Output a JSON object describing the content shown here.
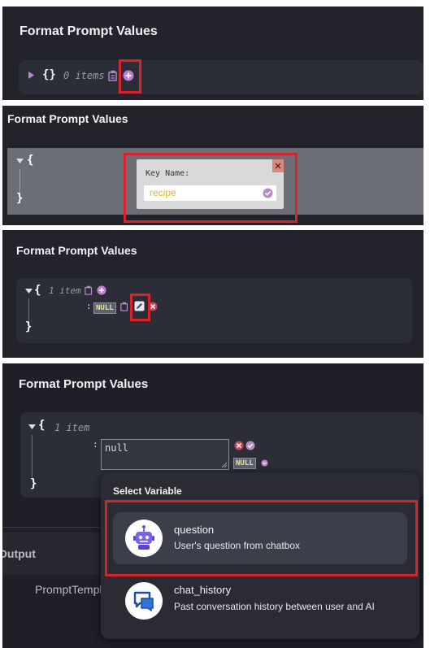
{
  "colors": {
    "panel_bg": "#22232b",
    "json_bg": "#2b2d37",
    "highlight": "#d8232a",
    "accent_purple": "#c27ad9",
    "null_text": "#f0e2a0"
  },
  "panel1": {
    "title": "Format Prompt Values",
    "brace": "{}",
    "items_count": "0 items",
    "icons": [
      "caret-right-icon",
      "copy-icon",
      "plus-circle-icon"
    ]
  },
  "panel2": {
    "title": "Format Prompt Values",
    "brace_open": "{",
    "brace_close": "}",
    "dialog": {
      "label": "Key Name:",
      "value": "recipe"
    }
  },
  "panel3": {
    "title": "Format Prompt Values",
    "brace_open": "{",
    "brace_close": "}",
    "items_count": "1 item",
    "colon": ":",
    "null_label": "NULL"
  },
  "panel4": {
    "title": "Format Prompt Values",
    "brace_open": "{",
    "brace_close": "}",
    "items_count": "1 item",
    "colon": ":",
    "textarea_value": "null",
    "null_label": "NULL",
    "bg_fragments": {
      "output": "Output",
      "prompt_template": "PromptTempl"
    },
    "select_variable": {
      "title": "Select Variable",
      "items": [
        {
          "name": "question",
          "desc": "User's question from chatbox",
          "icon": "robot-icon"
        },
        {
          "name": "chat_history",
          "desc": "Past conversation history between user and AI",
          "icon": "chat-icon"
        }
      ]
    }
  }
}
